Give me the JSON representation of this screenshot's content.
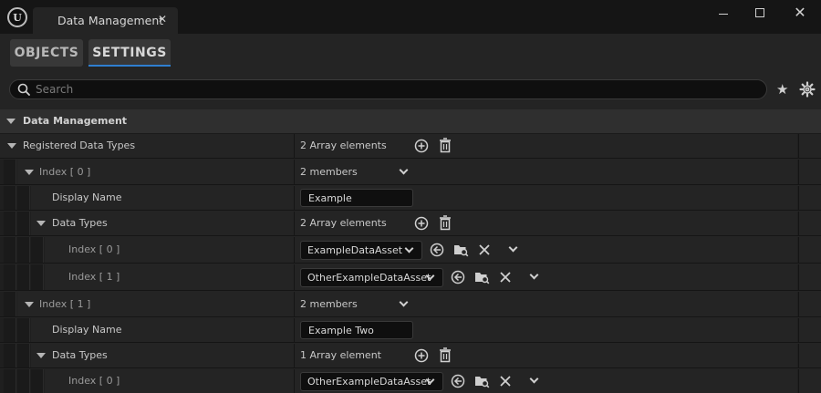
{
  "window": {
    "tab_title": "Data Management",
    "close_glyph": "✕"
  },
  "panel_tabs": [
    {
      "label": "OBJECTS",
      "active": false
    },
    {
      "label": "SETTINGS",
      "active": true
    }
  ],
  "search": {
    "placeholder": "Search",
    "value": ""
  },
  "category": {
    "label": "Data Management"
  },
  "properties": {
    "registered": {
      "label": "Registered Data Types",
      "value": "2 Array elements"
    },
    "index0": {
      "label": "Index [ 0 ]",
      "value": "2 members",
      "display_name_label": "Display Name",
      "display_name_value": "Example",
      "data_types_label": "Data Types",
      "data_types_value": "2 Array elements",
      "items": [
        {
          "label": "Index [ 0 ]",
          "value": "ExampleDataAsset"
        },
        {
          "label": "Index [ 1 ]",
          "value": "OtherExampleDataAsset"
        }
      ]
    },
    "index1": {
      "label": "Index [ 1 ]",
      "value": "2 members",
      "display_name_label": "Display Name",
      "display_name_value": "Example Two",
      "data_types_label": "Data Types",
      "data_types_value": "1 Array element",
      "items": [
        {
          "label": "Index [ 0 ]",
          "value": "OtherExampleDataAsset"
        }
      ]
    }
  },
  "icons": {
    "add": "add-element-icon",
    "delete": "trash-icon",
    "use_selected": "use-selected-asset-icon",
    "browse": "browse-to-asset-icon",
    "clear": "clear-icon",
    "more": "chevron-down-icon",
    "favorite": "star-icon",
    "settings": "gear-icon"
  },
  "colors": {
    "accent": "#2f7fd0",
    "background": "#242424",
    "field": "#0f0f0f"
  }
}
